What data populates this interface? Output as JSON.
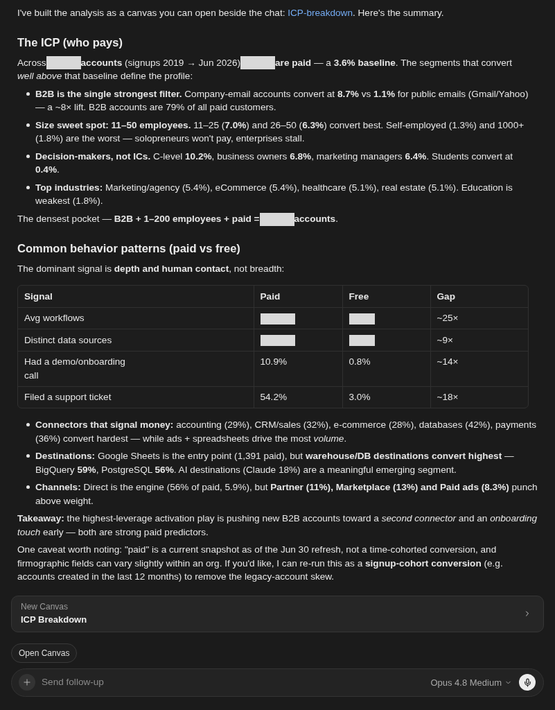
{
  "intro": {
    "text": "I've built the analysis as a canvas you can open beside the chat: ",
    "link": "ICP-breakdown",
    "text_after": ". Here's the summary."
  },
  "sections": [
    {
      "heading": "The ICP (who pays)",
      "blocks": [
        {
          "kind": "paragraph",
          "segments": [
            {
              "kind": "text",
              "text": "Across"
            },
            {
              "kind": "redacted"
            },
            {
              "kind": "text",
              "text": "**accounts** (signups 2019 → Jun 2026)"
            },
            {
              "kind": "redacted"
            },
            {
              "kind": "text",
              "text": "**are paid** — a **3.6% baseline**. The segments that convert"
            },
            {
              "kind": "text",
              "text": "*well above* that baseline define the profile:"
            }
          ]
        },
        {
          "kind": "bullets",
          "items": [
            "**B2B is the single strongest filter.** Company-email accounts convert at **8.7%** vs **1.1%** for public emails (Gmail/Yahoo) — a ~8× lift. B2B accounts are 79% of all paid customers.",
            "**Size sweet spot: 11–50 employees.** 11–25 (**7.0%**) and 26–50 (**6.3%**) convert best. Self-employed (1.3%) and 1000+ (1.8%) are the worst — solopreneurs won't pay, enterprises stall.",
            "**Decision-makers, not ICs.** C-level **10.2%**, business owners **6.8%**, marketing managers **6.4%**. Students convert at **0.4%**.",
            "**Top industries:** Marketing/agency (5.4%), eCommerce (5.4%), healthcare (5.1%), real estate (5.1%). Education is weakest (1.8%)."
          ]
        },
        {
          "kind": "paragraph",
          "segments": [
            {
              "kind": "text",
              "text": "The densest pocket — **B2B + 1–200 employees + paid =**"
            },
            {
              "kind": "redacted"
            },
            {
              "kind": "text",
              "text": "**accounts**."
            }
          ]
        }
      ]
    },
    {
      "heading": "Common behavior patterns (paid vs free)",
      "blocks": [
        {
          "kind": "paragraph",
          "segments": [
            {
              "kind": "text",
              "text": "The dominant signal is **depth and human contact**, not breadth:"
            }
          ]
        },
        {
          "kind": "table",
          "columns": [
            "Signal",
            "Paid",
            "Free",
            "Gap"
          ],
          "rows": [
            [
              {
                "kind": "text",
                "text": "Avg workflows"
              },
              {
                "kind": "redacted"
              },
              {
                "kind": "redacted"
              },
              {
                "kind": "text",
                "text": "~25×"
              }
            ],
            [
              {
                "kind": "text",
                "text": "Distinct data sources"
              },
              {
                "kind": "redacted"
              },
              {
                "kind": "redacted"
              },
              {
                "kind": "text",
                "text": "~9×"
              }
            ],
            [
              {
                "kind": "text",
                "text": "Had a demo/onboarding call"
              },
              {
                "kind": "text",
                "text": "10.9%"
              },
              {
                "kind": "text",
                "text": "0.8%"
              },
              {
                "kind": "text",
                "text": "~14×"
              }
            ],
            [
              {
                "kind": "text",
                "text": "Filed a support ticket"
              },
              {
                "kind": "text",
                "text": "54.2%"
              },
              {
                "kind": "text",
                "text": "3.0%"
              },
              {
                "kind": "text",
                "text": "~18×"
              }
            ]
          ]
        },
        {
          "kind": "bullets",
          "items": [
            "**Connectors that signal money:** accounting (29%), CRM/sales (32%), e-commerce (28%), databases (42%), payments (36%) convert hardest — while ads + spreadsheets drive the most *volume*.",
            "**Destinations:** Google Sheets is the entry point (1,391 paid), but **warehouse/DB destinations convert highest** — BigQuery **59%**, PostgreSQL **56%**. AI destinations (Claude 18%) are a meaningful emerging segment.",
            "**Channels:** Direct is the engine (56% of paid, 5.9%), but **Partner (11%), Marketplace (13%) and Paid ads (8.3%)** punch above weight."
          ]
        },
        {
          "kind": "paragraph",
          "segments": [
            {
              "kind": "text",
              "text": "**Takeaway:** the highest-leverage activation play is pushing new B2B accounts toward a *second connector* and an *onboarding touch* early — both are strong paid predictors."
            }
          ]
        },
        {
          "kind": "paragraph",
          "segments": [
            {
              "kind": "text",
              "text": "One caveat worth noting: \"paid\" is a current snapshot as of the Jun 30 refresh, not a time-cohorted conversion, and firmographic fields can vary slightly within an org. If you'd like, I can re-run this as a **signup-cohort conversion** (e.g. accounts created in the last 12 months) to remove the legacy-account skew."
            }
          ]
        }
      ]
    }
  ],
  "canvas_card": {
    "label": "New Canvas",
    "title": "ICP Breakdown"
  },
  "open_button": "Open Canvas",
  "composer": {
    "placeholder": "Send follow-up",
    "model": "Opus 4.8 Medium"
  }
}
